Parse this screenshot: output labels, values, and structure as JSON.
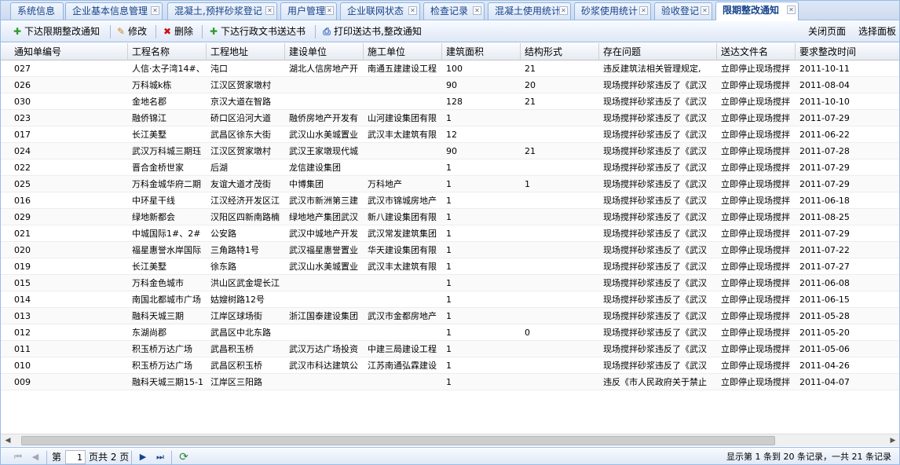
{
  "tabs": [
    {
      "label": "系统信息",
      "closable": false,
      "active": false
    },
    {
      "label": "企业基本信息管理",
      "closable": true,
      "active": false
    },
    {
      "label": "混凝土,预拌砂浆登记",
      "closable": true,
      "active": false
    },
    {
      "label": "用户管理",
      "closable": true,
      "active": false
    },
    {
      "label": "企业联网状态",
      "closable": true,
      "active": false
    },
    {
      "label": "检查记录",
      "closable": true,
      "active": false
    },
    {
      "label": "混凝土使用统计",
      "closable": true,
      "active": false
    },
    {
      "label": "砂浆使用统计",
      "closable": true,
      "active": false
    },
    {
      "label": "验收登记",
      "closable": true,
      "active": false
    },
    {
      "label": "限期整改通知",
      "closable": true,
      "active": true
    }
  ],
  "toolbar": {
    "issue_notice": "下达限期整改通知",
    "edit": "修改",
    "delete": "删除",
    "issue_doc": "下达行政文书送达书",
    "print": "打印送达书,整改通知",
    "close_page": "关闭页面",
    "select_panel": "选择面板"
  },
  "icons": {
    "add": "plus-icon",
    "edit": "pencil-icon",
    "delete": "red-x-icon",
    "print": "print-preview-icon",
    "tab_close": "close-icon"
  },
  "colors": {
    "add": "#2e9a2e",
    "delete": "#cc1111",
    "edit": "#c98a1a",
    "tab_text": "#15428b"
  },
  "columns": [
    "通知单编号",
    "工程名称",
    "工程地址",
    "建设单位",
    "施工单位",
    "建筑面积",
    "结构形式",
    "存在问题",
    "送达文件名",
    "要求整改时间"
  ],
  "rows": [
    [
      "027",
      "人信·太子湾14#、",
      "沌口",
      "湖北人信房地产开",
      "南通五建建设工程",
      "100",
      "21",
      "违反建筑法相关管理规定,",
      "立即停止现场搅拌",
      "2011-10-11"
    ],
    [
      "026",
      "万科城k栋",
      "江汉区贺家墩村",
      "",
      "",
      "90",
      "20",
      "现场搅拌砂浆违反了《武汉",
      "立即停止现场搅拌",
      "2011-08-04"
    ],
    [
      "030",
      "金地名郡",
      "京汉大道在智路",
      "",
      "",
      "128",
      "21",
      "现场搅拌砂浆违反了《武汉",
      "立即停止现场搅拌",
      "2011-10-10"
    ],
    [
      "023",
      "融侨锦江",
      "硚口区沿河大道",
      "融侨房地产开发有",
      "山河建设集团有限",
      "1",
      "",
      "现场搅拌砂浆违反了《武汉",
      "立即停止现场搅拌",
      "2011-07-29"
    ],
    [
      "017",
      "长江美墅",
      "武昌区徐东大街",
      "武汉山水美城置业",
      "武汉丰太建筑有限",
      "12",
      "",
      "现场搅拌砂浆违反了《武汉",
      "立即停止现场搅拌",
      "2011-06-22"
    ],
    [
      "024",
      "武汉万科城三期珏",
      "江汉区贺家墩村",
      "武汉王家墩现代城",
      "",
      "90",
      "21",
      "现场搅拌砂浆违反了《武汉",
      "立即停止现场搅拌",
      "2011-07-28"
    ],
    [
      "022",
      "晋合金桥世家",
      "后湖",
      "龙信建设集团",
      "",
      "1",
      "",
      "现场搅拌砂浆违反了《武汉",
      "立即停止现场搅拌",
      "2011-07-29"
    ],
    [
      "025",
      "万科金城华府二期",
      "友谊大道才茂街",
      "中博集团",
      "万科地产",
      "1",
      "1",
      "现场搅拌砂浆违反了《武汉",
      "立即停止现场搅拌",
      "2011-07-29"
    ],
    [
      "016",
      "中环星干线",
      "江汉经济开发区江",
      "武汉市新洲第三建",
      "武汉市锦城房地产",
      "1",
      "",
      "现场搅拌砂浆违反了《武汉",
      "立即停止现场搅拌",
      "2011-06-18"
    ],
    [
      "029",
      "绿地新都会",
      "汉阳区四新南路楠",
      "绿地地产集团武汉",
      "新八建设集团有限",
      "1",
      "",
      "现场搅拌砂浆违反了《武汉",
      "立即停止现场搅拌",
      "2011-08-25"
    ],
    [
      "021",
      "中城国际1#、2#",
      "公安路",
      "武汉中城地产开发",
      "武汉常发建筑集团",
      "1",
      "",
      "现场搅拌砂浆违反了《武汉",
      "立即停止现场搅拌",
      "2011-07-29"
    ],
    [
      "020",
      "福星惠誉水岸国际",
      "三角路特1号",
      "武汉福星惠誉置业",
      "华天建设集团有限",
      "1",
      "",
      "现场搅拌砂浆违反了《武汉",
      "立即停止现场搅拌",
      "2011-07-22"
    ],
    [
      "019",
      "长江美墅",
      "徐东路",
      "武汉山水美城置业",
      "武汉丰太建筑有限",
      "1",
      "",
      "现场搅拌砂浆违反了《武汉",
      "立即停止现场搅拌",
      "2011-07-27"
    ],
    [
      "015",
      "万科金色城市",
      "洪山区武金堤长江",
      "",
      "",
      "1",
      "",
      "现场搅拌砂浆违反了《武汉",
      "立即停止现场搅拌",
      "2011-06-08"
    ],
    [
      "014",
      "南国北都城市广场",
      "姑嫂树路12号",
      "",
      "",
      "1",
      "",
      "现场搅拌砂浆违反了《武汉",
      "立即停止现场搅拌",
      "2011-06-15"
    ],
    [
      "013",
      "融科天城三期",
      "江岸区球场街",
      "浙江国泰建设集团",
      "武汉市金都房地产",
      "1",
      "",
      "现场搅拌砂浆违反了《武汉",
      "立即停止现场搅拌",
      "2011-05-28"
    ],
    [
      "012",
      "东湖尚郡",
      "武昌区中北东路",
      "",
      "",
      "1",
      "0",
      "现场搅拌砂浆违反了《武汉",
      "立即停止现场搅拌",
      "2011-05-20"
    ],
    [
      "011",
      "积玉桥万达广场",
      "武昌积玉桥",
      "武汉万达广场投资",
      "中建三局建设工程",
      "1",
      "",
      "现场搅拌砂浆违反了《武汉",
      "立即停止现场搅拌",
      "2011-05-06"
    ],
    [
      "010",
      "积玉桥万达广场",
      "武昌区积玉桥",
      "武汉市科达建筑公",
      "江苏南通弘霖建设",
      "1",
      "",
      "现场搅拌砂浆违反了《武汉",
      "立即停止现场搅拌",
      "2011-04-26"
    ],
    [
      "009",
      "融科天城三期15-1",
      "江岸区三阳路",
      "",
      "",
      "1",
      "",
      "违反《市人民政府关于禁止",
      "立即停止现场搅拌",
      "2011-04-07"
    ]
  ],
  "paging": {
    "page_prefix": "第",
    "current_page": "1",
    "page_suffix": "页共 2 页",
    "summary": "显示第 1 条到 20 条记录，一共 21 条记录"
  }
}
